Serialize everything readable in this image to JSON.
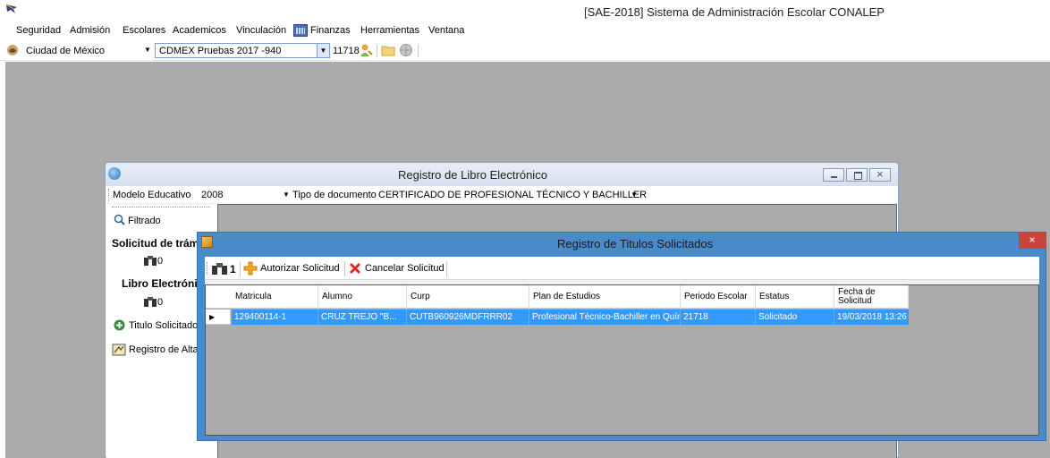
{
  "app": {
    "title": "[SAE-2018] Sistema de Administración Escolar CONALEP"
  },
  "menu": {
    "items": [
      "Seguridad",
      "Admisión",
      "Escolares",
      "Academicos",
      "Vinculación",
      "Finanzas",
      "Herramientas",
      "Ventana"
    ]
  },
  "toolbar": {
    "city": "Ciudad de México",
    "plantel": "CDMEX Pruebas 2017 -940",
    "period": "11718"
  },
  "libro_window": {
    "title": "Registro de Libro Electrónico",
    "modelo_label": "Modelo Educativo",
    "modelo_value": "2008",
    "tipo_label": "Tipo de documento",
    "tipo_value": "CERTIFICADO DE PROFESIONAL TÉCNICO Y BACHILLER",
    "filtrado": "Filtrado",
    "solicitud_header": "Solicitud de trám",
    "solicitud_count": "0",
    "libro_header": "Libro Electrónic",
    "libro_count": "0",
    "titulo_solicitado": "Titulo Solicitado",
    "registro_alta": "Registro de Alta"
  },
  "titulos_window": {
    "title": "Registro de Titulos Solicitados",
    "close": "×",
    "count": "1",
    "autorizar": "Autorizar Solicitud",
    "cancelar": "Cancelar Solicitud",
    "columns": [
      "Matricula",
      "Alumno",
      "Curp",
      "Plan de Estudios",
      "Periodo Escolar",
      "Estatus",
      "Fecha de Solicitud"
    ],
    "rows": [
      {
        "matricula": "129400114-1",
        "alumno": "CRUZ TREJO \"B...",
        "curp": "CUTB960926MDFRRR02",
        "plan": "Profesional Técnico-Bachiller en Quími...",
        "periodo": "21718",
        "estatus": "Solicitado",
        "fecha": "19/03/2018 13:26"
      }
    ]
  },
  "colors": {
    "workspace": "#ababab",
    "dialog_frame": "#4b8ac8",
    "selection": "#3399ff",
    "close_red": "#c7453a"
  }
}
